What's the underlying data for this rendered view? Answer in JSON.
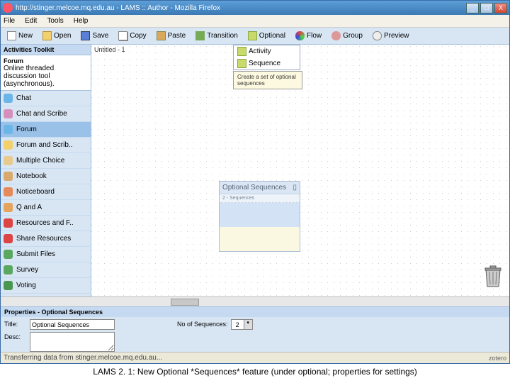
{
  "titlebar": {
    "text": "http://stinger.melcoe.mq.edu.au - LAMS :: Author - Mozilla Firefox"
  },
  "winbtns": {
    "min": "_",
    "max": "□",
    "close": "X"
  },
  "menubar": [
    "File",
    "Edit",
    "Tools",
    "Help"
  ],
  "toolbar": {
    "new": "New",
    "open": "Open",
    "save": "Save",
    "copy": "Copy",
    "paste": "Paste",
    "transition": "Transition",
    "optional": "Optional",
    "flow": "Flow",
    "group": "Group",
    "preview": "Preview"
  },
  "sidebar": {
    "title": "Activities Toolkit",
    "selected_name": "Forum",
    "selected_desc": "Online threaded discussion tool (asynchronous).",
    "items": [
      {
        "label": "Chat",
        "color": "#6bb6e8"
      },
      {
        "label": "Chat and Scribe",
        "color": "#d68fbd"
      },
      {
        "label": "Forum",
        "color": "#6bb6e8",
        "selected": true
      },
      {
        "label": "Forum and Scrib..",
        "color": "#f2d06b"
      },
      {
        "label": "Multiple Choice",
        "color": "#e8ca8c"
      },
      {
        "label": "Notebook",
        "color": "#d8a86c"
      },
      {
        "label": "Noticeboard",
        "color": "#e68a5c"
      },
      {
        "label": "Q and A",
        "color": "#e6a35c"
      },
      {
        "label": "Resources and F..",
        "color": "#d44"
      },
      {
        "label": "Share Resources",
        "color": "#d44"
      },
      {
        "label": "Submit Files",
        "color": "#5aa860"
      },
      {
        "label": "Survey",
        "color": "#5aa860"
      },
      {
        "label": "Voting",
        "color": "#4a9850"
      }
    ]
  },
  "canvas": {
    "title": "Untitled - 1",
    "dropmenu": {
      "activity": "Activity",
      "sequence": "Sequence"
    },
    "tooltip": "Create a set of optional sequences",
    "optbox": {
      "title": "Optional Sequences",
      "sub": "2 - Sequences"
    }
  },
  "props": {
    "title": "Properties - Optional Sequences",
    "title_label": "Title:",
    "title_value": "Optional Sequences",
    "desc_label": "Desc:",
    "noseq_label": "No of Sequences:",
    "noseq_value": "2"
  },
  "status": {
    "text": "Transferring data from stinger.melcoe.mq.edu.au...",
    "zotero": "zotero"
  },
  "caption": "LAMS 2. 1: New Optional *Sequences* feature (under optional; properties for settings)"
}
